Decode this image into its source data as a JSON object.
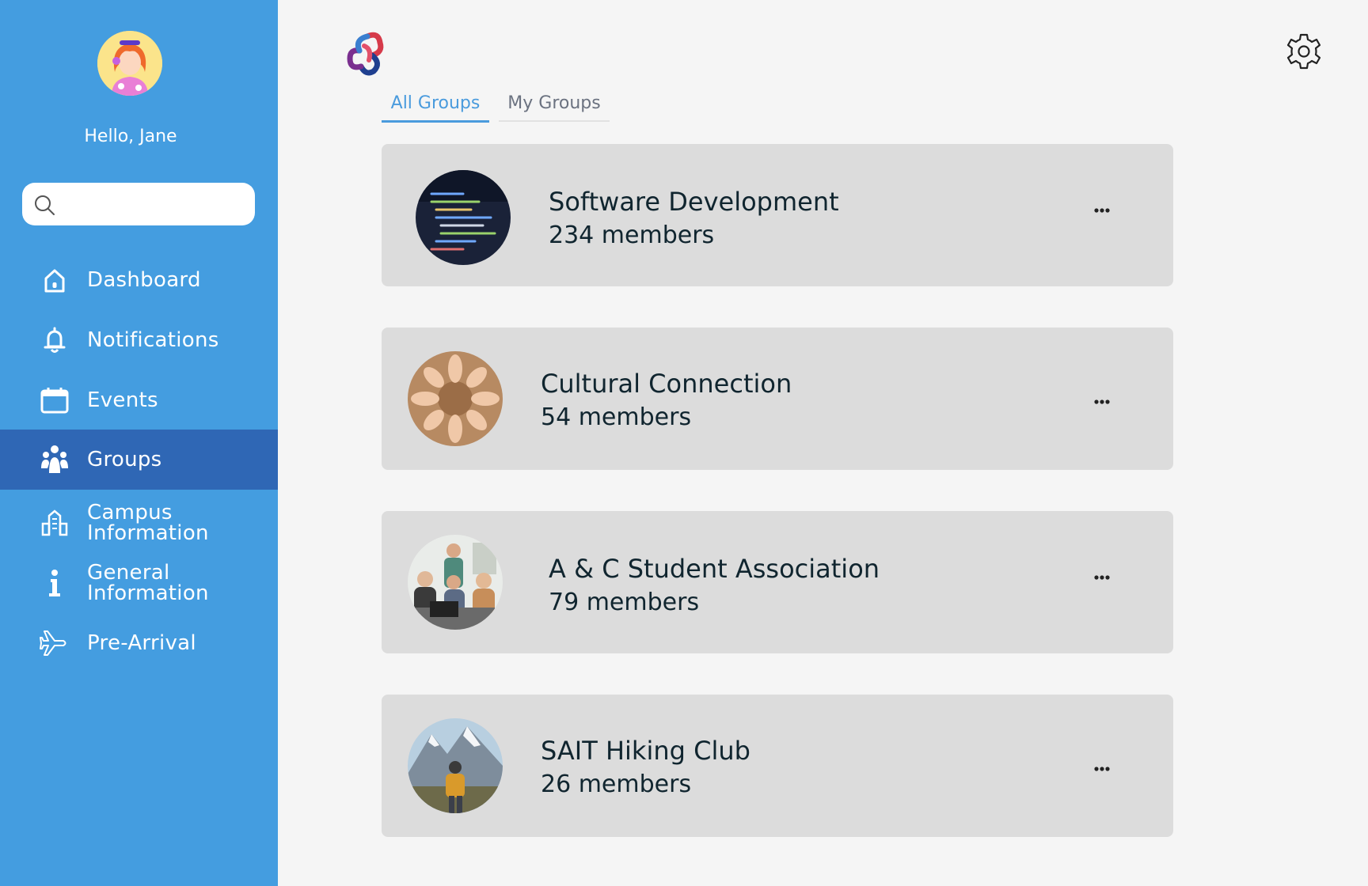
{
  "sidebar": {
    "greeting": "Hello, Jane",
    "search": {
      "placeholder": "",
      "value": ""
    },
    "items": [
      {
        "label": "Dashboard",
        "icon": "home-icon"
      },
      {
        "label": "Notifications",
        "icon": "bell-icon"
      },
      {
        "label": "Events",
        "icon": "calendar-icon"
      },
      {
        "label": "Groups",
        "icon": "people-icon",
        "active": true
      },
      {
        "label_line1": "Campus",
        "label_line2": "Information",
        "icon": "building-icon"
      },
      {
        "label_line1": "General",
        "label_line2": "Information",
        "icon": "info-icon"
      },
      {
        "label": "Pre-Arrival",
        "icon": "airplane-icon"
      }
    ],
    "color": "#449de0",
    "active_color": "#2f67b5"
  },
  "tabs": [
    {
      "label": "All Groups",
      "active": true
    },
    {
      "label": "My Groups",
      "active": false
    }
  ],
  "groups": [
    {
      "name": "Software Development",
      "members": "234 members",
      "image": "code-screen-photo"
    },
    {
      "name": "Cultural Connection",
      "members": "54 members",
      "image": "hands-circle-photo"
    },
    {
      "name": "A & C Student Association",
      "members": "79 members",
      "image": "students-laptop-photo"
    },
    {
      "name": "SAIT Hiking Club",
      "members": "26 members",
      "image": "hiker-mountain-photo"
    }
  ],
  "accent": "#4a9bdd"
}
